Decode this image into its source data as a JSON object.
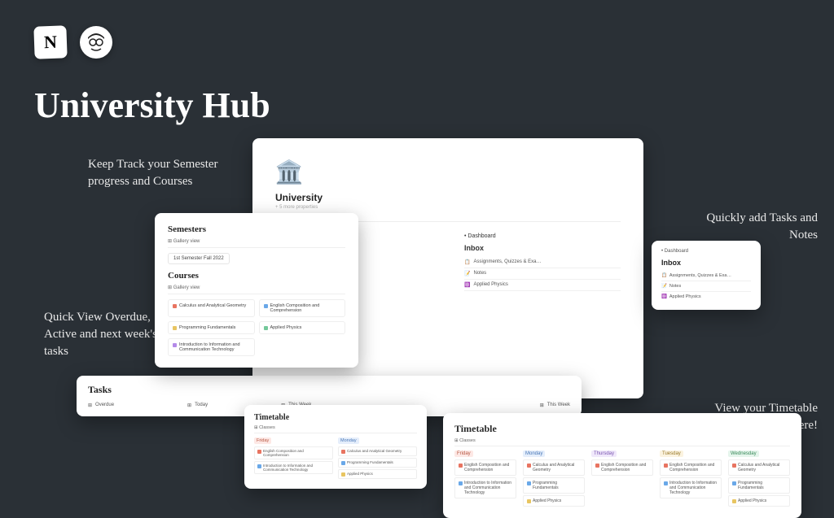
{
  "hero": {
    "title": "University Hub",
    "logo_letter": "N"
  },
  "annotations": {
    "semesters": "Keep Track your Semester progress and Courses",
    "tasks": "Quick View Overdue, Active and next week's tasks",
    "inbox": "Quickly add Tasks and Notes",
    "timetable": "View your Timetable here!"
  },
  "main_page": {
    "title": "University",
    "subtitle": "+ 5 more properties",
    "dashboard_label": "• Dashboard",
    "inbox_title": "Inbox",
    "inbox_items": [
      "Assignments, Quizzes & Exa…",
      "Notes",
      "Applied Physics"
    ]
  },
  "semesters_card": {
    "title_semesters": "Semesters",
    "title_courses": "Courses",
    "gallery_view": "⊞ Gallery view",
    "semester_pill": "1st Semester Fall 2022",
    "courses": [
      "Calculus and Analytical Geometry",
      "English Composition and Comprehension",
      "Programming Fundamentals",
      "Applied Physics",
      "Introduction to Information and Communication Technology"
    ]
  },
  "inbox_card": {
    "dashboard_label": "• Dashboard",
    "title": "Inbox",
    "items": [
      "Assignments, Quizzes & Exa…",
      "Notes",
      "Applied Physics"
    ]
  },
  "tasks_card": {
    "title": "Tasks",
    "columns": [
      "Overdue",
      "Today",
      "This Week",
      "This Week"
    ]
  },
  "timetable_small": {
    "title": "Timetable",
    "view": "⊞ Classes",
    "days": [
      {
        "name": "Friday",
        "cls": "hdr-fri",
        "items": [
          "English Composition and Comprehension",
          "Introduction to Information and Communication Technology"
        ]
      },
      {
        "name": "Monday",
        "cls": "hdr-mon",
        "items": [
          "Calculus and Analytical Geometry",
          "Programming Fundamentals",
          "Applied Physics"
        ]
      }
    ]
  },
  "timetable_big": {
    "title": "Timetable",
    "view": "⊞ Classes",
    "days": [
      {
        "name": "Friday",
        "cls": "hdr-fri",
        "items": [
          "English Composition and Comprehension",
          "Introduction to Information and Communication Technology"
        ]
      },
      {
        "name": "Monday",
        "cls": "hdr-mon",
        "items": [
          "Calculus and Analytical Geometry",
          "Programming Fundamentals",
          "Applied Physics"
        ]
      },
      {
        "name": "Thursday",
        "cls": "hdr-thu",
        "items": [
          "English Composition and Comprehension"
        ]
      },
      {
        "name": "Tuesday",
        "cls": "hdr-tue",
        "items": [
          "English Composition and Comprehension",
          "Introduction to Information and Communication Technology"
        ]
      },
      {
        "name": "Wednesday",
        "cls": "hdr-wed",
        "items": [
          "Calculus and Analytical Geometry",
          "Programming Fundamentals",
          "Applied Physics"
        ]
      }
    ]
  }
}
